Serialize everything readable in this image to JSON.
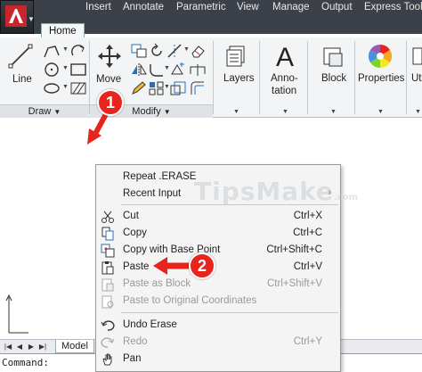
{
  "app": {
    "menu_icon": "autocad-logo-icon"
  },
  "ribbon": {
    "tabs": [
      "Home",
      "Insert",
      "Annotate",
      "Parametric",
      "View",
      "Manage",
      "Output",
      "Express Tools",
      "Ut"
    ],
    "active_tab": "Home",
    "panels": {
      "draw": {
        "label": "Draw",
        "line_label": "Line"
      },
      "modify": {
        "label": "Modify",
        "move_label": "Move"
      },
      "layers_label": "Layers",
      "annotation_label_1": "Anno-",
      "annotation_label_2": "tation",
      "block_label": "Block",
      "properties_label": "Properties",
      "utilities_label": "Ut"
    }
  },
  "model_tab": {
    "label": "Model"
  },
  "command_line": {
    "prompt": "Command:"
  },
  "watermark": {
    "text": "TipsMake",
    "suffix": ".com"
  },
  "context_menu": {
    "items": [
      {
        "label": "Repeat .ERASE",
        "shortcut": "",
        "icon": "none",
        "disabled": false
      },
      {
        "label": "Recent Input",
        "shortcut": "",
        "icon": "none",
        "disabled": false,
        "submenu": "›"
      },
      {
        "label": "Cut",
        "shortcut": "Ctrl+X",
        "icon": "scissors-icon",
        "disabled": false
      },
      {
        "label": "Copy",
        "shortcut": "Ctrl+C",
        "icon": "copy-icon",
        "disabled": false
      },
      {
        "label": "Copy with Base Point",
        "shortcut": "Ctrl+Shift+C",
        "icon": "copy-base-point-icon",
        "disabled": false
      },
      {
        "label": "Paste",
        "shortcut": "Ctrl+V",
        "icon": "paste-icon",
        "disabled": false
      },
      {
        "label": "Paste as Block",
        "shortcut": "Ctrl+Shift+V",
        "icon": "paste-block-icon",
        "disabled": true
      },
      {
        "label": "Paste to Original Coordinates",
        "shortcut": "",
        "icon": "paste-original-icon",
        "disabled": true
      },
      {
        "label": "Undo Erase",
        "shortcut": "",
        "icon": "undo-icon",
        "disabled": false
      },
      {
        "label": "Redo",
        "shortcut": "Ctrl+Y",
        "icon": "redo-icon",
        "disabled": true
      },
      {
        "label": "Pan",
        "shortcut": "",
        "icon": "pan-icon",
        "disabled": false
      }
    ]
  },
  "callouts": {
    "step1": "1",
    "step2": "2",
    "color": "#e8251c"
  }
}
